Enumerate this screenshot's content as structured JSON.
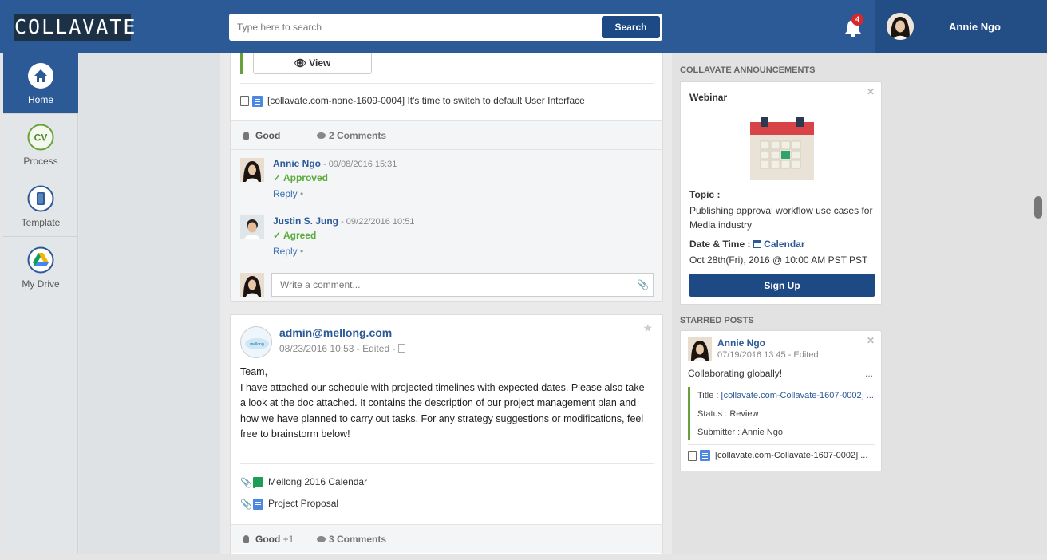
{
  "header": {
    "logo_text": "COLLAVATE",
    "search_placeholder": "Type here to search",
    "search_button": "Search",
    "notification_count": "4",
    "user_name": "Annie Ngo"
  },
  "nav": {
    "items": [
      {
        "label": "Home"
      },
      {
        "label": "Process",
        "icon_text": "CV"
      },
      {
        "label": "Template"
      },
      {
        "label": "My Drive"
      }
    ]
  },
  "post1": {
    "view_button": "View",
    "doc_title": "[collavate.com-none-1609-0004] It's time to switch to default User Interface",
    "good_label": "Good",
    "comments_label": "2 Comments",
    "comments": [
      {
        "name": "Annie Ngo",
        "date": " - 09/08/2016 15:31",
        "status": "✓ Approved",
        "reply": "Reply",
        "dot": " •"
      },
      {
        "name": "Justin S. Jung",
        "date": " - 09/22/2016 10:51",
        "status": "✓ Agreed",
        "reply": "Reply",
        "dot": " •"
      }
    ],
    "comment_placeholder": "Write a comment..."
  },
  "post2": {
    "author": "admin@mellong.com",
    "date": "08/23/2016 10:53 - Edited -",
    "body": "Team,\nI have attached our schedule with projected timelines with expected dates. Please also take a look at the doc attached. It contains the description of our project management plan and how we have planned to carry out tasks. For any strategy suggestions or modifications, feel free to brainstorm below!",
    "attachments": [
      {
        "title": "Mellong 2016 Calendar",
        "type": "sheet"
      },
      {
        "title": "Project Proposal",
        "type": "doc"
      }
    ],
    "good_label": "Good",
    "good_count": "+1",
    "comments_label": "3 Comments"
  },
  "sidebar": {
    "announcements_title": "COLLAVATE ANNOUNCEMENTS",
    "webinar": {
      "title": "Webinar",
      "topic_label": "Topic :",
      "topic_text": "Publishing approval workflow use cases for Media industry",
      "date_label": "Date & Time :",
      "calendar_link": "Calendar",
      "date_text": "Oct 28th(Fri), 2016 @ 10:00 AM PST PST",
      "signup_button": "Sign Up"
    },
    "starred_title": "STARRED POSTS",
    "starred": {
      "name": "Annie Ngo",
      "date": "07/19/2016 13:45 - Edited",
      "text": "Collaborating globally!",
      "more": "...",
      "title_label": "Title : ",
      "title_value": "[collavate.com-Collavate-1607-0002] ...",
      "status": "Status : Review",
      "submitter": "Submitter : Annie Ngo",
      "doc": "[collavate.com-Collavate-1607-0002] ..."
    }
  },
  "colors": {
    "header_blue": "#2c5a96",
    "button_blue": "#1d4a85",
    "approved_green": "#5aab3b",
    "accent_green": "#68a13a",
    "badge_red": "#d9272a"
  }
}
